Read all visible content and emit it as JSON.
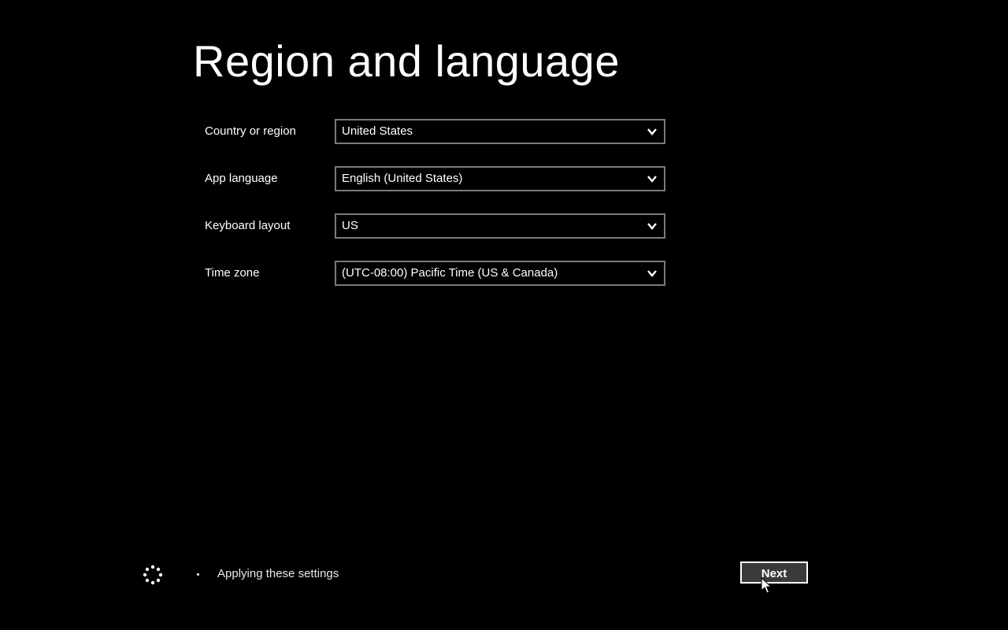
{
  "page": {
    "title": "Region and language"
  },
  "form": {
    "fields": [
      {
        "label": "Country or region",
        "value": "United States"
      },
      {
        "label": "App language",
        "value": "English (United States)"
      },
      {
        "label": "Keyboard layout",
        "value": "US"
      },
      {
        "label": "Time zone",
        "value": "(UTC-08:00) Pacific Time (US & Canada)"
      }
    ]
  },
  "footer": {
    "status_text": "Applying these settings",
    "next_label": "Next"
  },
  "icons": {
    "dropdown": "chevron-down-icon",
    "status": "spinner-icon",
    "pointer": "mouse-cursor-icon"
  },
  "colors": {
    "background": "#000000",
    "text": "#ffffff",
    "field_border": "#7a7a7a",
    "button_fill": "#3a3a3a"
  }
}
